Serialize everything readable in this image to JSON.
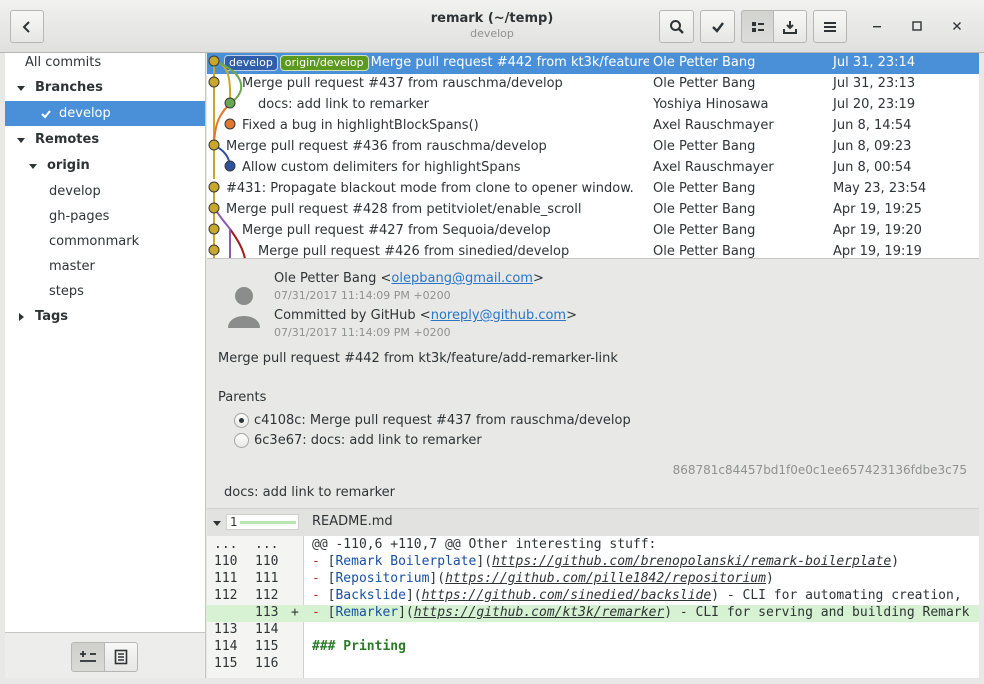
{
  "window": {
    "title": "remark (~/temp)",
    "subtitle": "develop"
  },
  "colors": {
    "accent": "#4a90d9",
    "local_ref": "#2f5fa8",
    "remote_ref": "#5b9a1f"
  },
  "sidebar": {
    "all_commits": "All commits",
    "branches_header": "Branches",
    "branch_develop": "develop",
    "remotes_header": "Remotes",
    "origin": "origin",
    "remote_branches": [
      "develop",
      "gh-pages",
      "commonmark",
      "master",
      "steps"
    ],
    "tags_header": "Tags"
  },
  "commits": [
    {
      "message": "Merge pull request #442 from kt3k/feature/add-remarker-link",
      "author": "Ole Petter Bang",
      "date": "Jul 31, 23:14",
      "refs": [
        "develop",
        "origin/develop"
      ]
    },
    {
      "message": "Merge pull request #437 from rauschma/develop",
      "author": "Ole Petter Bang",
      "date": "Jul 31, 23:13"
    },
    {
      "message": "docs: add link to remarker",
      "author": "Yoshiya Hinosawa",
      "date": "Jul 20, 23:19"
    },
    {
      "message": "Fixed a bug in highlightBlockSpans()",
      "author": "Axel Rauschmayer",
      "date": "Jun  8, 14:54"
    },
    {
      "message": "Merge pull request #436 from rauschma/develop",
      "author": "Ole Petter Bang",
      "date": "Jun  8, 09:23"
    },
    {
      "message": "Allow custom delimiters for highlightSpans",
      "author": "Axel Rauschmayer",
      "date": "Jun  8, 00:54"
    },
    {
      "message": "#431: Propagate blackout mode from clone to opener window.",
      "author": "Ole Petter Bang",
      "date": "May 23, 23:54"
    },
    {
      "message": "Merge pull request #428 from petitviolet/enable_scroll",
      "author": "Ole Petter Bang",
      "date": "Apr 19, 19:25"
    },
    {
      "message": "Merge pull request #427 from Sequoia/develop",
      "author": "Ole Petter Bang",
      "date": "Apr 19, 19:20"
    },
    {
      "message": "Merge pull request #426 from sinedied/develop",
      "author": "Ole Petter Bang",
      "date": "Apr 19, 19:19"
    }
  ],
  "details": {
    "author_name": "Ole Petter Bang <",
    "author_email": "olepbang@gmail.com",
    "author_close": ">",
    "author_date": "07/31/2017 11:14:09 PM +0200",
    "committer_prefix": "Committed by GitHub <",
    "committer_email": "noreply@github.com",
    "committer_close": ">",
    "committer_date": "07/31/2017 11:14:09 PM +0200",
    "message": "Merge pull request #442 from kt3k/feature/add-remarker-link",
    "parents_header": "Parents",
    "parents": [
      {
        "label": "c4108c: Merge pull request #437 from rauschma/develop",
        "selected": true
      },
      {
        "label": "6c3e67: docs: add link to remarker",
        "selected": false
      }
    ],
    "sha": "868781c84457bd1f0e0c1ee657423136fdbe3c75",
    "parent_message": "docs: add link to remarker"
  },
  "diff": {
    "file_count": "1",
    "file_name": "README.md",
    "lines": [
      {
        "old": "...",
        "new": "...",
        "sign": "",
        "type": "hunk",
        "text": "@@ -110,6 +110,7 @@ Other interesting stuff:"
      },
      {
        "old": "110",
        "new": "110",
        "sign": "",
        "type": "ctx",
        "link": "Remark Boilerplate",
        "url": "https://github.com/brenopolanski/remark-boilerplate",
        "rest": ")"
      },
      {
        "old": "111",
        "new": "111",
        "sign": "",
        "type": "ctx",
        "link": "Repositorium",
        "url": "https://github.com/pille1842/repositorium",
        "rest": ")"
      },
      {
        "old": "112",
        "new": "112",
        "sign": "",
        "type": "ctx",
        "link": "Backslide",
        "url": "https://github.com/sinedied/backslide",
        "rest": ") - CLI for automating creation,"
      },
      {
        "old": "",
        "new": "113",
        "sign": "+",
        "type": "add",
        "link": "Remarker",
        "url": "https://github.com/kt3k/remarker",
        "rest": ") - CLI for serving and building Remark"
      },
      {
        "old": "113",
        "new": "114",
        "sign": "",
        "type": "blank",
        "text": ""
      },
      {
        "old": "114",
        "new": "115",
        "sign": "",
        "type": "heading",
        "text": "### Printing"
      },
      {
        "old": "115",
        "new": "116",
        "sign": "",
        "type": "blank",
        "text": ""
      }
    ]
  }
}
